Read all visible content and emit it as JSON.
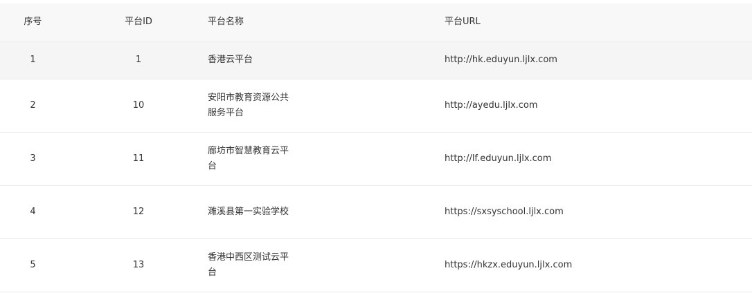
{
  "table": {
    "headers": {
      "no": "序号",
      "id": "平台ID",
      "name": "平台名称",
      "url": "平台URL"
    },
    "rows": [
      {
        "no": "1",
        "id": "1",
        "name": "香港云平台",
        "url": "http://hk.eduyun.ljlx.com"
      },
      {
        "no": "2",
        "id": "10",
        "name": "安阳市教育资源公共服务平台",
        "url": "http://ayedu.ljlx.com"
      },
      {
        "no": "3",
        "id": "11",
        "name": "廊坊市智慧教育云平台",
        "url": "http://lf.eduyun.ljlx.com"
      },
      {
        "no": "4",
        "id": "12",
        "name": "濉溪县第一实验学校",
        "url": "https://sxsyschool.ljlx.com"
      },
      {
        "no": "5",
        "id": "13",
        "name": "香港中西区测试云平台",
        "url": "https://hkzx.eduyun.ljlx.com"
      }
    ]
  }
}
